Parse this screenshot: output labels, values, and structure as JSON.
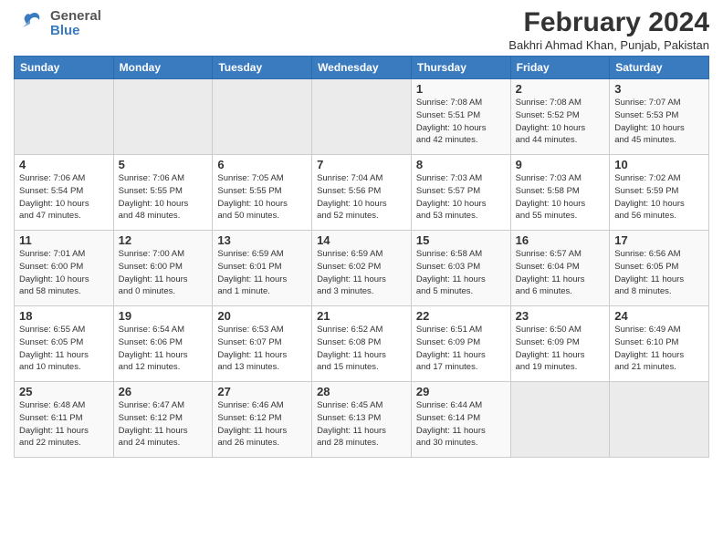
{
  "header": {
    "logo_general": "General",
    "logo_blue": "Blue",
    "month_title": "February 2024",
    "location": "Bakhri Ahmad Khan, Punjab, Pakistan"
  },
  "weekdays": [
    "Sunday",
    "Monday",
    "Tuesday",
    "Wednesday",
    "Thursday",
    "Friday",
    "Saturday"
  ],
  "weeks": [
    [
      {
        "num": "",
        "info": ""
      },
      {
        "num": "",
        "info": ""
      },
      {
        "num": "",
        "info": ""
      },
      {
        "num": "",
        "info": ""
      },
      {
        "num": "1",
        "info": "Sunrise: 7:08 AM\nSunset: 5:51 PM\nDaylight: 10 hours\nand 42 minutes."
      },
      {
        "num": "2",
        "info": "Sunrise: 7:08 AM\nSunset: 5:52 PM\nDaylight: 10 hours\nand 44 minutes."
      },
      {
        "num": "3",
        "info": "Sunrise: 7:07 AM\nSunset: 5:53 PM\nDaylight: 10 hours\nand 45 minutes."
      }
    ],
    [
      {
        "num": "4",
        "info": "Sunrise: 7:06 AM\nSunset: 5:54 PM\nDaylight: 10 hours\nand 47 minutes."
      },
      {
        "num": "5",
        "info": "Sunrise: 7:06 AM\nSunset: 5:55 PM\nDaylight: 10 hours\nand 48 minutes."
      },
      {
        "num": "6",
        "info": "Sunrise: 7:05 AM\nSunset: 5:55 PM\nDaylight: 10 hours\nand 50 minutes."
      },
      {
        "num": "7",
        "info": "Sunrise: 7:04 AM\nSunset: 5:56 PM\nDaylight: 10 hours\nand 52 minutes."
      },
      {
        "num": "8",
        "info": "Sunrise: 7:03 AM\nSunset: 5:57 PM\nDaylight: 10 hours\nand 53 minutes."
      },
      {
        "num": "9",
        "info": "Sunrise: 7:03 AM\nSunset: 5:58 PM\nDaylight: 10 hours\nand 55 minutes."
      },
      {
        "num": "10",
        "info": "Sunrise: 7:02 AM\nSunset: 5:59 PM\nDaylight: 10 hours\nand 56 minutes."
      }
    ],
    [
      {
        "num": "11",
        "info": "Sunrise: 7:01 AM\nSunset: 6:00 PM\nDaylight: 10 hours\nand 58 minutes."
      },
      {
        "num": "12",
        "info": "Sunrise: 7:00 AM\nSunset: 6:00 PM\nDaylight: 11 hours\nand 0 minutes."
      },
      {
        "num": "13",
        "info": "Sunrise: 6:59 AM\nSunset: 6:01 PM\nDaylight: 11 hours\nand 1 minute."
      },
      {
        "num": "14",
        "info": "Sunrise: 6:59 AM\nSunset: 6:02 PM\nDaylight: 11 hours\nand 3 minutes."
      },
      {
        "num": "15",
        "info": "Sunrise: 6:58 AM\nSunset: 6:03 PM\nDaylight: 11 hours\nand 5 minutes."
      },
      {
        "num": "16",
        "info": "Sunrise: 6:57 AM\nSunset: 6:04 PM\nDaylight: 11 hours\nand 6 minutes."
      },
      {
        "num": "17",
        "info": "Sunrise: 6:56 AM\nSunset: 6:05 PM\nDaylight: 11 hours\nand 8 minutes."
      }
    ],
    [
      {
        "num": "18",
        "info": "Sunrise: 6:55 AM\nSunset: 6:05 PM\nDaylight: 11 hours\nand 10 minutes."
      },
      {
        "num": "19",
        "info": "Sunrise: 6:54 AM\nSunset: 6:06 PM\nDaylight: 11 hours\nand 12 minutes."
      },
      {
        "num": "20",
        "info": "Sunrise: 6:53 AM\nSunset: 6:07 PM\nDaylight: 11 hours\nand 13 minutes."
      },
      {
        "num": "21",
        "info": "Sunrise: 6:52 AM\nSunset: 6:08 PM\nDaylight: 11 hours\nand 15 minutes."
      },
      {
        "num": "22",
        "info": "Sunrise: 6:51 AM\nSunset: 6:09 PM\nDaylight: 11 hours\nand 17 minutes."
      },
      {
        "num": "23",
        "info": "Sunrise: 6:50 AM\nSunset: 6:09 PM\nDaylight: 11 hours\nand 19 minutes."
      },
      {
        "num": "24",
        "info": "Sunrise: 6:49 AM\nSunset: 6:10 PM\nDaylight: 11 hours\nand 21 minutes."
      }
    ],
    [
      {
        "num": "25",
        "info": "Sunrise: 6:48 AM\nSunset: 6:11 PM\nDaylight: 11 hours\nand 22 minutes."
      },
      {
        "num": "26",
        "info": "Sunrise: 6:47 AM\nSunset: 6:12 PM\nDaylight: 11 hours\nand 24 minutes."
      },
      {
        "num": "27",
        "info": "Sunrise: 6:46 AM\nSunset: 6:12 PM\nDaylight: 11 hours\nand 26 minutes."
      },
      {
        "num": "28",
        "info": "Sunrise: 6:45 AM\nSunset: 6:13 PM\nDaylight: 11 hours\nand 28 minutes."
      },
      {
        "num": "29",
        "info": "Sunrise: 6:44 AM\nSunset: 6:14 PM\nDaylight: 11 hours\nand 30 minutes."
      },
      {
        "num": "",
        "info": ""
      },
      {
        "num": "",
        "info": ""
      }
    ]
  ]
}
